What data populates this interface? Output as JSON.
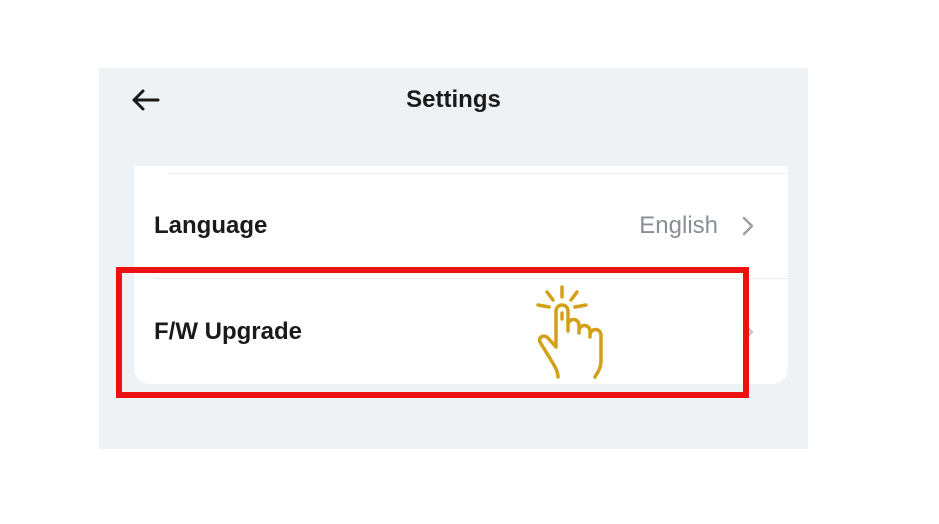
{
  "header": {
    "title": "Settings",
    "back_icon": "arrow-left-icon"
  },
  "settings": {
    "items": [
      {
        "label": "Language",
        "value": "English",
        "icon": "chevron-right-icon"
      },
      {
        "label": "F/W Upgrade",
        "value": "",
        "icon": "chevron-right-icon"
      }
    ]
  },
  "overlay": {
    "highlight_color": "#ee1111",
    "tap_icon": "hand-tap-icon",
    "tap_icon_color": "#d4a017"
  },
  "colors": {
    "screen_background": "#eff2f5",
    "card_background": "#ffffff",
    "text_primary": "#1a1a1a",
    "text_secondary": "#8a8f96"
  }
}
